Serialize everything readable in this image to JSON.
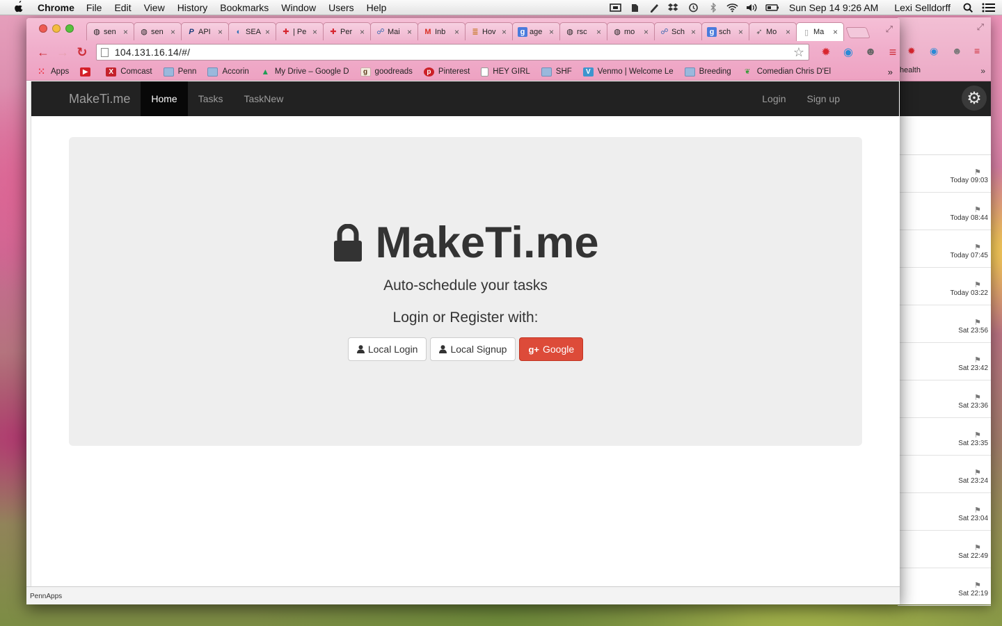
{
  "menubar": {
    "app": "Chrome",
    "items": [
      "File",
      "Edit",
      "View",
      "History",
      "Bookmarks",
      "Window",
      "Users",
      "Help"
    ],
    "clock": "Sun Sep 14  9:26 AM",
    "user": "Lexi Selldorff"
  },
  "tabs": [
    {
      "label": "sen",
      "icon": "github-icon"
    },
    {
      "label": "sen",
      "icon": "github-icon"
    },
    {
      "label": "API",
      "icon": "paypal-icon"
    },
    {
      "label": "SEA",
      "icon": "globe-icon"
    },
    {
      "label": "| Pe",
      "icon": "pennapps-icon"
    },
    {
      "label": "Per",
      "icon": "pennapps-icon"
    },
    {
      "label": "Mai",
      "icon": "people-icon"
    },
    {
      "label": "Inb",
      "icon": "gmail-icon"
    },
    {
      "label": "Hov",
      "icon": "stack-icon"
    },
    {
      "label": "age",
      "icon": "google-icon"
    },
    {
      "label": "rsc",
      "icon": "github-icon"
    },
    {
      "label": "mo",
      "icon": "github-icon"
    },
    {
      "label": "Sch",
      "icon": "people-icon"
    },
    {
      "label": "sch",
      "icon": "google-icon"
    },
    {
      "label": "Mo",
      "icon": "bird-icon"
    },
    {
      "label": "Ma",
      "icon": "page-icon"
    }
  ],
  "address_bar": {
    "url": "104.131.16.14/#/"
  },
  "bookmarks": [
    {
      "label": "Apps",
      "icon": "apps-icon"
    },
    {
      "label": "",
      "icon": "youtube-icon"
    },
    {
      "label": "Comcast",
      "icon": "xfinity-icon"
    },
    {
      "label": "Penn",
      "icon": "folder-icon"
    },
    {
      "label": "Accorin",
      "icon": "folder-icon"
    },
    {
      "label": "My Drive – Google D",
      "icon": "drive-icon"
    },
    {
      "label": "goodreads",
      "icon": "goodreads-icon"
    },
    {
      "label": "Pinterest",
      "icon": "pinterest-icon"
    },
    {
      "label": "HEY GIRL",
      "icon": "page-icon"
    },
    {
      "label": "SHF",
      "icon": "folder-icon"
    },
    {
      "label": "Venmo | Welcome Le",
      "icon": "venmo-icon"
    },
    {
      "label": "Breeding",
      "icon": "folder-icon"
    },
    {
      "label": "Comedian Chris D'El",
      "icon": "chris-icon"
    }
  ],
  "bookmarks_more": "»",
  "navbar": {
    "brand": "MakeTi.me",
    "links": [
      "Home",
      "Tasks",
      "TaskNew"
    ],
    "right_links": [
      "Login",
      "Sign up"
    ]
  },
  "hero": {
    "title": "MakeTi.me",
    "subtitle": "Auto-schedule your tasks",
    "prompt": "Login or Register with:",
    "buttons": {
      "local_login": "Local Login",
      "local_signup": "Local Signup",
      "google": "Google",
      "google_glyph": "g+"
    }
  },
  "status_bar": "PennApps",
  "background_window": {
    "bookmark": "health",
    "times": [
      "Today 09:03",
      "Today 08:44",
      "Today 07:45",
      "Today 03:22",
      "Sat 23:56",
      "Sat 23:42",
      "Sat 23:36",
      "Sat 23:35",
      "Sat 23:24",
      "Sat 23:04",
      "Sat 22:49",
      "Sat 22:19"
    ]
  }
}
